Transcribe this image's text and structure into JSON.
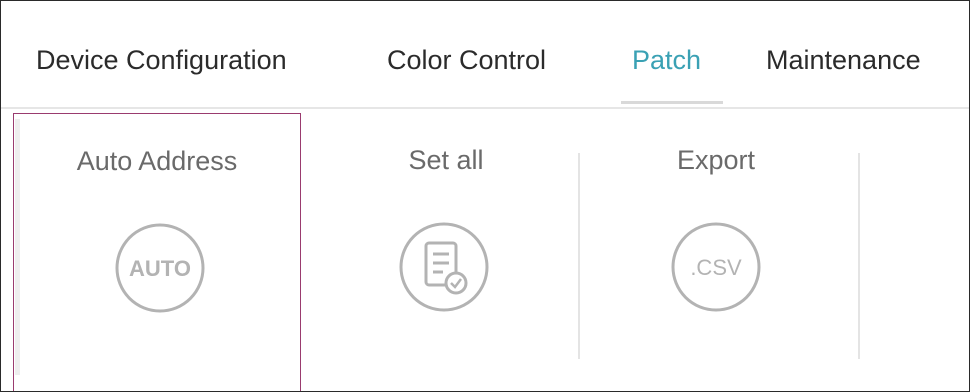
{
  "tabs": [
    {
      "label": "Device Configuration",
      "active": false
    },
    {
      "label": "Color Control",
      "active": false
    },
    {
      "label": "Patch",
      "active": true
    },
    {
      "label": "Maintenance",
      "active": false
    }
  ],
  "tools": [
    {
      "label": "Auto Address",
      "icon": "auto-icon",
      "icon_text": "AUTO",
      "selected": true
    },
    {
      "label": "Set all",
      "icon": "document-check-icon",
      "selected": false
    },
    {
      "label": "Export",
      "icon": "csv-icon",
      "icon_text": ".CSV",
      "selected": false
    }
  ],
  "colors": {
    "active_tab": "#3aa1b4",
    "selection_border": "#9a3b6f",
    "icon_gray": "#b3b3b3",
    "text": "#2b2b2b",
    "tool_label": "#6a6a6a"
  }
}
